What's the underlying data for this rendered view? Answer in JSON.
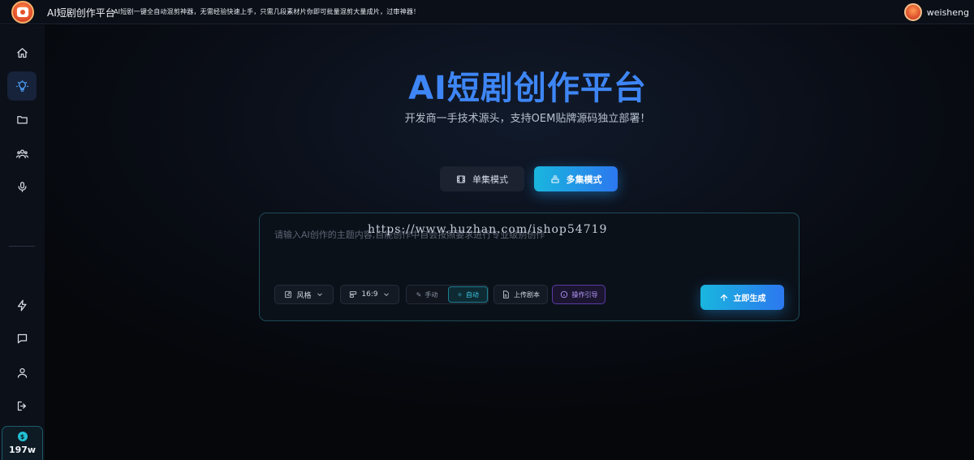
{
  "header": {
    "title": "AI短剧创作平台",
    "tagline": "AI短剧一键全自动混剪神器，无需经验快速上手，只需几段素材片你即可批量混剪大量成片，过审神器！",
    "username": "weisheng"
  },
  "sidebar": {
    "items": [
      {
        "icon": "home-icon"
      },
      {
        "icon": "lightbulb-icon"
      },
      {
        "icon": "folder-icon"
      },
      {
        "icon": "users-icon"
      },
      {
        "icon": "microphone-icon"
      },
      {
        "icon": "lightning-icon"
      },
      {
        "icon": "message-icon"
      },
      {
        "icon": "user-icon"
      },
      {
        "icon": "logout-icon"
      }
    ],
    "balance": {
      "icon": "dollar-icon",
      "value": "197w"
    }
  },
  "hero": {
    "title": "AI短剧创作平台",
    "subtitle": "开发商一手技术源头，支持OEM贴牌源码独立部署！"
  },
  "modes": {
    "single": "单集模式",
    "multi": "多集模式"
  },
  "composer": {
    "placeholder": "请输入AI创作的主题内容,自能创作中自会按照要求进行专业级别创作",
    "watermark": "https://www.huzhan.com/ishop54719",
    "style_label": "风格",
    "ratio_label": "16:9",
    "manual_label": "手动",
    "auto_label": "自动",
    "upload_label": "上传剧本",
    "guide_label": "操作引导",
    "generate_label": "立即生成"
  },
  "colors": {
    "accent": "#2c78ef",
    "accent_cyan": "#19b6de",
    "guide_purple": "#b89cff"
  }
}
